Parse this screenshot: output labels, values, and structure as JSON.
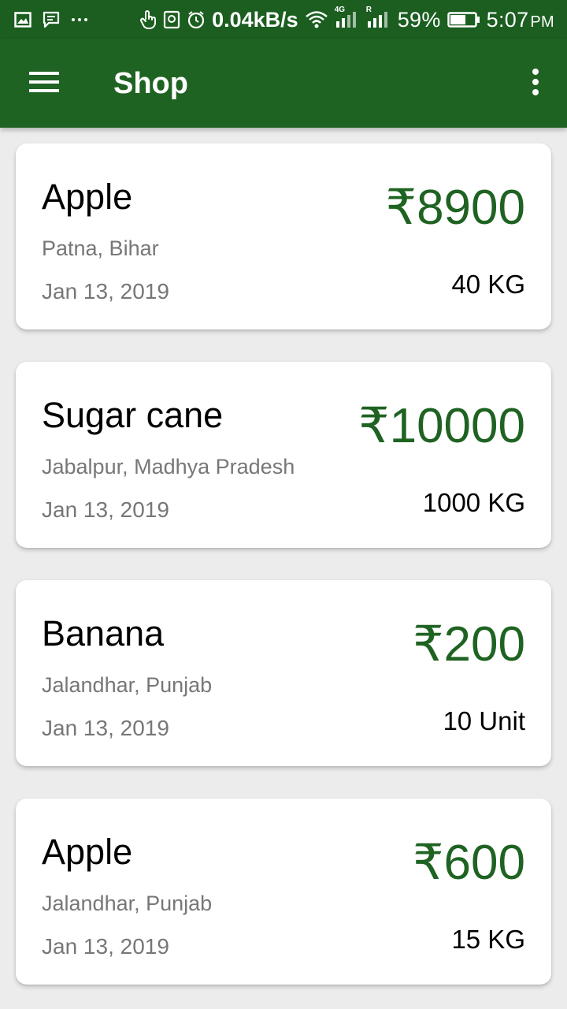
{
  "status_bar": {
    "network_speed": "0.04kB/s",
    "battery_percent": "59%",
    "time": "5:07",
    "time_suffix": "PM",
    "sim1_tag": "4G",
    "sim2_tag": "R",
    "icons": [
      "gallery-icon",
      "message-icon",
      "more-dots-icon",
      "touch-icon",
      "screenshot-icon",
      "alarm-icon",
      "wifi-icon",
      "signal-icon",
      "signal-icon",
      "battery-icon"
    ]
  },
  "app_bar": {
    "title": "Shop",
    "menu_icon": "hamburger-menu-icon",
    "overflow_icon": "more-vert-icon",
    "color": "#1f6322"
  },
  "colors": {
    "primary": "#1f6322",
    "status_bar": "#1b5e20",
    "price": "#1f6322",
    "secondary_text": "#777777",
    "background": "#ececec"
  },
  "items": [
    {
      "name": "Apple",
      "location": "Patna, Bihar",
      "date": "Jan 13, 2019",
      "price": "₹8900",
      "quantity": "40 KG"
    },
    {
      "name": "Sugar cane",
      "location": "Jabalpur, Madhya Pradesh",
      "date": "Jan 13, 2019",
      "price": "₹10000",
      "quantity": "1000 KG"
    },
    {
      "name": "Banana",
      "location": "Jalandhar, Punjab",
      "date": "Jan 13, 2019",
      "price": "₹200",
      "quantity": "10 Unit"
    },
    {
      "name": "Apple",
      "location": "Jalandhar, Punjab",
      "date": "Jan 13, 2019",
      "price": "₹600",
      "quantity": "15 KG"
    }
  ]
}
